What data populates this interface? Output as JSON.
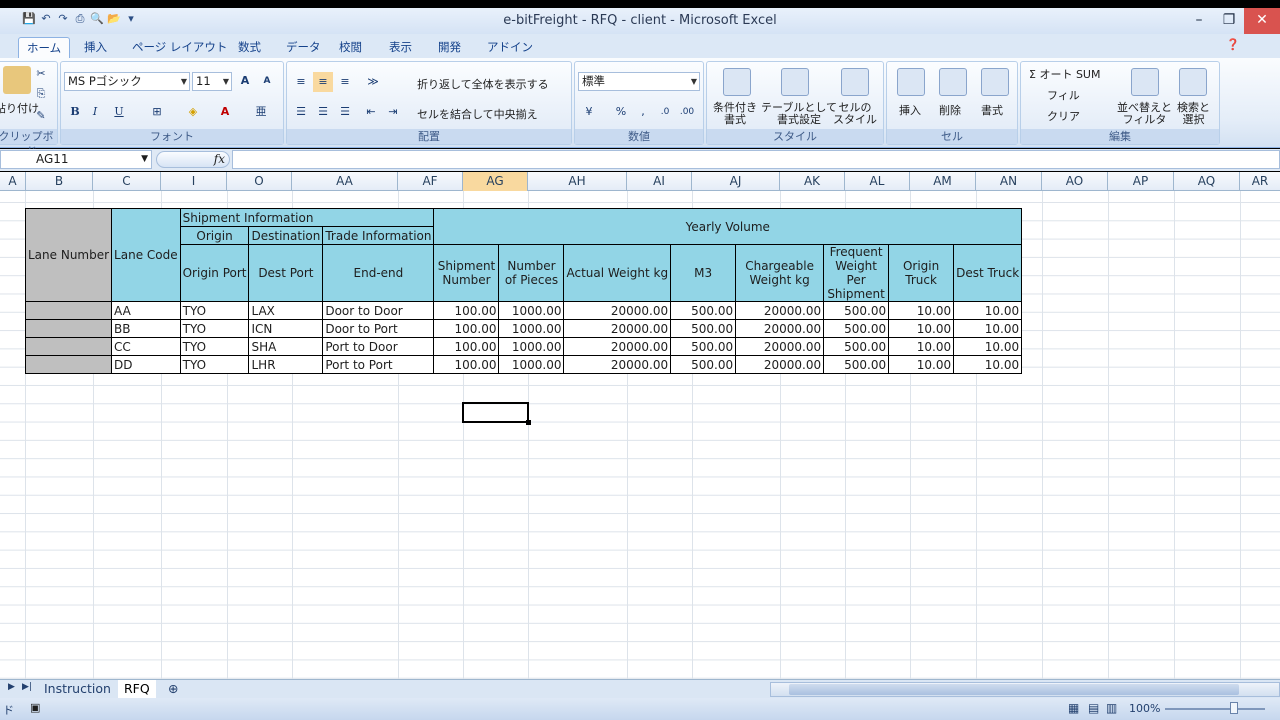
{
  "window": {
    "title": "e-bitFreight - RFQ - client - Microsoft Excel",
    "minimize": "–",
    "restore": "❐",
    "close": "✕"
  },
  "ribbon_tabs": [
    "ホーム",
    "挿入",
    "ページ レイアウト",
    "数式",
    "データ",
    "校閲",
    "表示",
    "開発",
    "アドイン"
  ],
  "ribbon": {
    "clipboard": {
      "paste": "貼り付け",
      "label": "クリップボード"
    },
    "font": {
      "name": "MS Pゴシック",
      "size": "11",
      "bold": "B",
      "italic": "I",
      "underline": "U",
      "label": "フォント"
    },
    "alignment": {
      "wrap": "折り返して全体を表示する",
      "merge": "セルを結合して中央揃え",
      "label": "配置"
    },
    "number": {
      "format": "標準",
      "label": "数値"
    },
    "styles": {
      "conditional": "条件付き\n書式",
      "table": "テーブルとして\n書式設定",
      "cell": "セルの\nスタイル",
      "label": "スタイル"
    },
    "cells": {
      "insert": "挿入",
      "delete": "削除",
      "format": "書式",
      "label": "セル"
    },
    "editing": {
      "autosum": "Σ オート SUM",
      "fill": "フィル",
      "clear": "クリア",
      "sort": "並べ替えと\nフィルタ",
      "find": "検索と\n選択",
      "label": "編集"
    }
  },
  "formula_bar": {
    "name_box": "AG11",
    "fx": "fx",
    "formula": ""
  },
  "columns": [
    {
      "name": "A",
      "w": 0
    },
    {
      "name": "B"
    },
    {
      "name": "C"
    },
    {
      "name": "I"
    },
    {
      "name": "O"
    },
    {
      "name": "AA"
    },
    {
      "name": "AF"
    },
    {
      "name": "AG"
    },
    {
      "name": "AH"
    },
    {
      "name": "AI"
    },
    {
      "name": "AJ"
    },
    {
      "name": "AK"
    },
    {
      "name": "AL"
    },
    {
      "name": "AM"
    },
    {
      "name": "AN"
    },
    {
      "name": "AO"
    },
    {
      "name": "AP"
    },
    {
      "name": "AQ"
    },
    {
      "name": "AR"
    }
  ],
  "table": {
    "lane_number": "Lane Number",
    "lane_code": "Lane Code",
    "shipment_information": "Shipment Information",
    "origin": "Origin",
    "destination": "Destination",
    "trade_information": "Trade Information",
    "origin_port": "Origin Port",
    "dest_port": "Dest Port",
    "end_end": "End-end",
    "yearly_volume": "Yearly Volume",
    "vol_headers": [
      "Shipment Number",
      "Number of Pieces",
      "Actual Weight kg",
      "M3",
      "Chargeable Weight kg",
      "Frequent Weight Per Shipment",
      "Origin Truck",
      "Dest Truck"
    ],
    "rows": [
      {
        "code": "AA",
        "origin": "TYO",
        "dest": "LAX",
        "trade": "Door to Door",
        "vals": [
          "100.00",
          "1000.00",
          "20000.00",
          "500.00",
          "20000.00",
          "500.00",
          "10.00",
          "10.00"
        ]
      },
      {
        "code": "BB",
        "origin": "TYO",
        "dest": "ICN",
        "trade": "Door to Port",
        "vals": [
          "100.00",
          "1000.00",
          "20000.00",
          "500.00",
          "20000.00",
          "500.00",
          "10.00",
          "10.00"
        ]
      },
      {
        "code": "CC",
        "origin": "TYO",
        "dest": "SHA",
        "trade": "Port to Door",
        "vals": [
          "100.00",
          "1000.00",
          "20000.00",
          "500.00",
          "20000.00",
          "500.00",
          "10.00",
          "10.00"
        ]
      },
      {
        "code": "DD",
        "origin": "TYO",
        "dest": "LHR",
        "trade": "Port to Port",
        "vals": [
          "100.00",
          "1000.00",
          "20000.00",
          "500.00",
          "20000.00",
          "500.00",
          "10.00",
          "10.00"
        ]
      }
    ]
  },
  "sheet_tabs": [
    "Instruction",
    "RFQ"
  ],
  "status": {
    "left": "ド",
    "zoom": "100%"
  }
}
